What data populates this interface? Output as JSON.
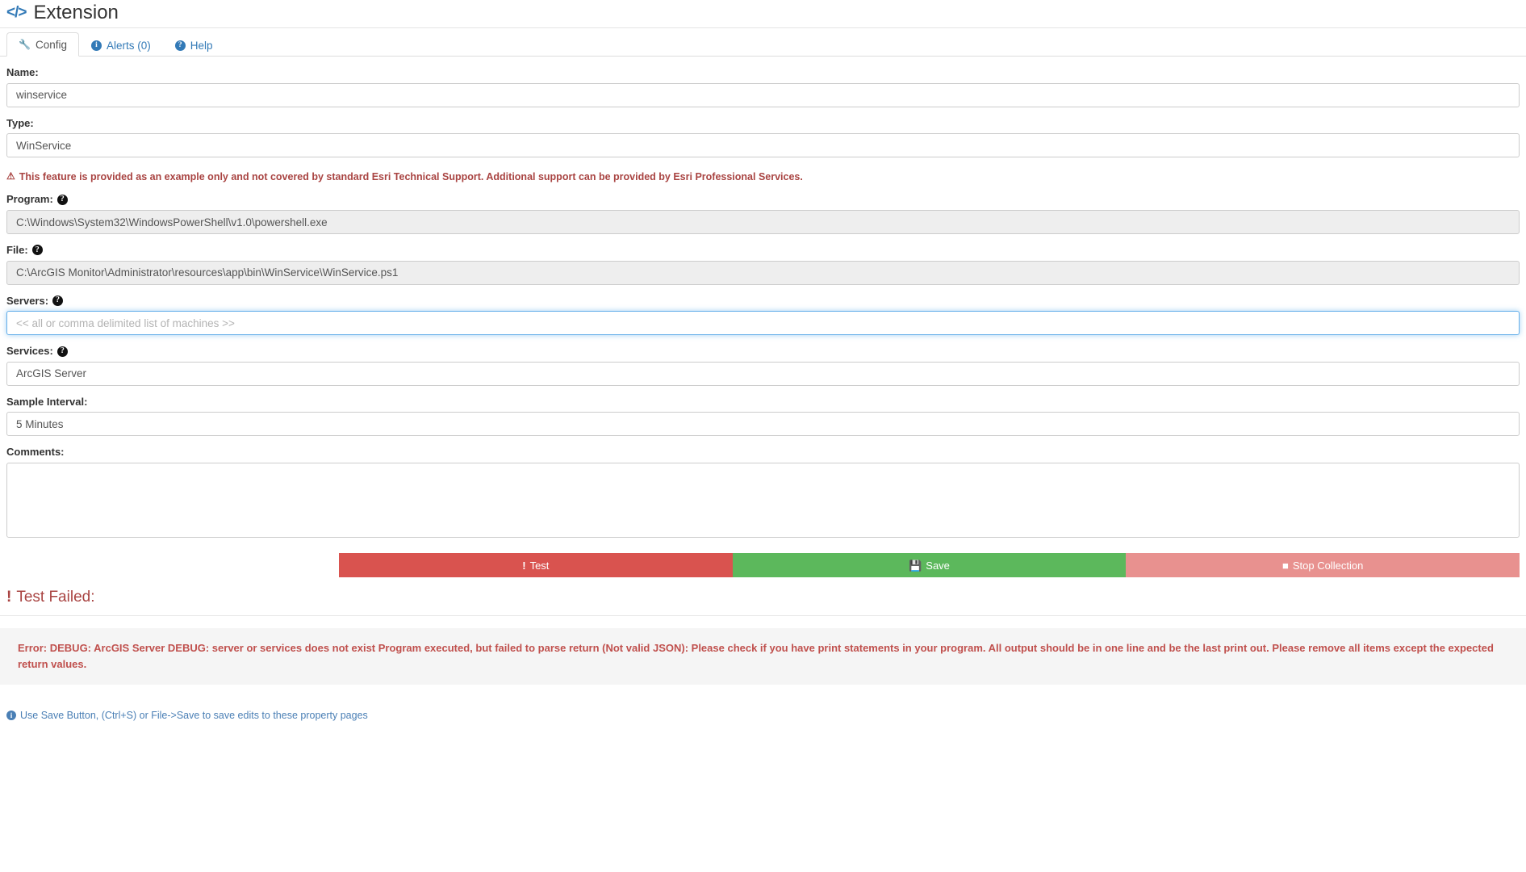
{
  "header": {
    "icon": "code-icon",
    "title": "Extension"
  },
  "tabs": [
    {
      "label": "Config",
      "icon": "wrench-icon",
      "active": true
    },
    {
      "label": "Alerts (0)",
      "icon": "info-circle-icon",
      "active": false
    },
    {
      "label": "Help",
      "icon": "question-circle-icon",
      "active": false
    }
  ],
  "form": {
    "name": {
      "label": "Name:",
      "value": "winservice",
      "placeholder": ""
    },
    "type": {
      "label": "Type:",
      "value": "WinService",
      "placeholder": ""
    },
    "warning": {
      "icon": "warning-triangle-icon",
      "text": "This feature is provided as an example only and not covered by standard Esri Technical Support. Additional support can be provided by Esri Professional Services."
    },
    "program": {
      "label": "Program:",
      "help": "?",
      "value": "C:\\Windows\\System32\\WindowsPowerShell\\v1.0\\powershell.exe",
      "disabled": true
    },
    "file": {
      "label": "File:",
      "help": "?",
      "value": "C:\\ArcGIS Monitor\\Administrator\\resources\\app\\bin\\WinService\\WinService.ps1",
      "disabled": true
    },
    "servers": {
      "label": "Servers:",
      "help": "?",
      "value": "",
      "placeholder": "<< all or comma delimited list of machines >>",
      "focused": true
    },
    "services": {
      "label": "Services:",
      "help": "?",
      "value": "ArcGIS Server",
      "placeholder": ""
    },
    "sample_interval": {
      "label": "Sample Interval:",
      "value": "5 Minutes",
      "placeholder": ""
    },
    "comments": {
      "label": "Comments:",
      "value": "",
      "placeholder": ""
    }
  },
  "buttons": {
    "test": {
      "label": "Test",
      "icon": "exclamation-icon",
      "color": "#d9534f"
    },
    "save": {
      "label": "Save",
      "icon": "floppy-disk-icon",
      "color": "#5cb85c"
    },
    "stop": {
      "label": "Stop Collection",
      "icon": "stop-square-icon",
      "color": "#e8918f"
    }
  },
  "result": {
    "heading": "Test Failed:",
    "heading_icon": "exclamation-icon",
    "error_message": "Error: DEBUG: ArcGIS Server DEBUG: server or services does not exist Program executed, but failed to parse return (Not valid JSON): Please check if you have print statements in your program. All output should be in one line and be the last print out. Please remove all items except the expected return values."
  },
  "footer": {
    "icon": "info-circle-icon",
    "text": "Use Save Button, (Ctrl+S) or File->Save to save edits to these property pages"
  }
}
